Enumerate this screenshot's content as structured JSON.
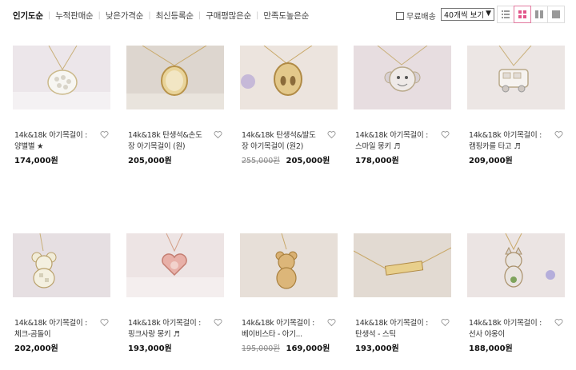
{
  "sort": {
    "options": [
      "인기도순",
      "누적판매순",
      "낮은가격순",
      "최신등록순",
      "구매평많은순",
      "만족도높은순"
    ]
  },
  "filter": {
    "free_shipping_label": "무료배송"
  },
  "per_page": {
    "selected": "40개씩 보기"
  },
  "view_modes": [
    "list-view-icon",
    "grid-4-icon",
    "grid-2-icon",
    "large-view-icon"
  ],
  "products": [
    {
      "name": "14k&18k 아기목걸이 : 양별별 ★",
      "old_price": "",
      "price": "174,000원",
      "image": "sheep-charm-necklace",
      "bg": "#e9e3e6"
    },
    {
      "name": "14k&18k 탄생석&손도장 아기목걸이 (원)",
      "old_price": "",
      "price": "205,000원",
      "image": "round-engraved-pendant",
      "bg": "#ddd6cf"
    },
    {
      "name": "14k&18k 탄생석&발도장 아기목걸이 (원2)",
      "old_price": "255,000원",
      "price": "205,000원",
      "image": "footprint-pendant",
      "bg": "#ebe3dd"
    },
    {
      "name": "14k&18k 아기목걸이 : 스마일 몽키 ♬",
      "old_price": "",
      "price": "178,000원",
      "image": "monkey-face-pendant",
      "bg": "#e8dee0"
    },
    {
      "name": "14k&18k 아기목걸이 : 캠핑카를 타고 ♬",
      "old_price": "",
      "price": "209,000원",
      "image": "camper-van-pendant",
      "bg": "#ece6e4"
    },
    {
      "name": "14k&18k 아기목걸이 : 체크-곰돌이",
      "old_price": "",
      "price": "202,000원",
      "image": "check-bear-pendant",
      "bg": "#e6dfe2"
    },
    {
      "name": "14k&18k 아기목걸이 : 핑크사랑 몽키 ♬",
      "old_price": "",
      "price": "193,000원",
      "image": "pink-monkey-heart-pendant",
      "bg": "#ede4e4"
    },
    {
      "name": "14k&18k 아기목걸이 : 베이비스타 - 아기...",
      "old_price": "195,000원",
      "price": "169,000원",
      "image": "teddy-bear-pendant",
      "bg": "#e7dfd8"
    },
    {
      "name": "14k&18k 아기목걸이 : 탄생석 - 스틱",
      "old_price": "",
      "price": "193,000원",
      "image": "bar-stick-pendant",
      "bg": "#e2dad2"
    },
    {
      "name": "14k&18k 아기목걸이 : 선사 야옹이",
      "old_price": "",
      "price": "188,000원",
      "image": "cat-pendant",
      "bg": "#ebe4e3"
    }
  ]
}
